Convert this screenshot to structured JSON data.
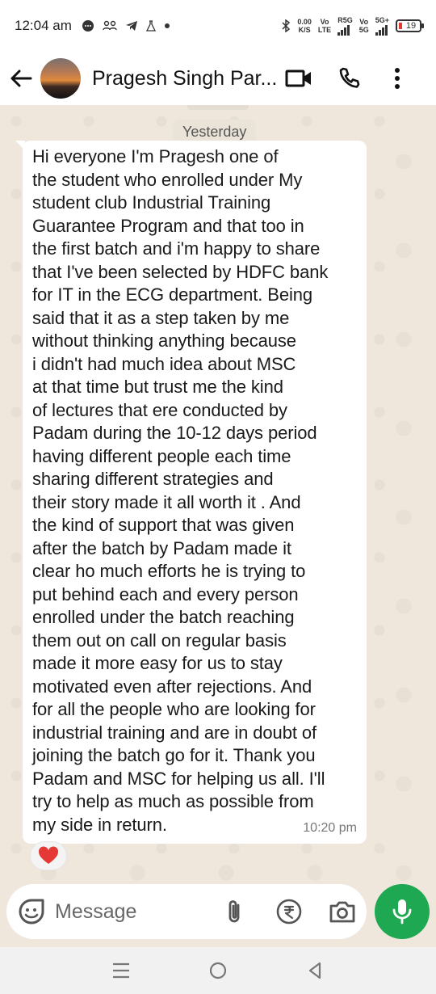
{
  "status_bar": {
    "time": "12:04 am",
    "speed_value": "0.00",
    "speed_unit": "K/S",
    "net1_top": "Vo",
    "net1_bottom": "LTE",
    "net1_type": "R5G",
    "net2_top": "Vo",
    "net2_bottom": "5G",
    "net2_type": "5G+",
    "battery": "19"
  },
  "header": {
    "contact_name": "Pragesh Singh Par..."
  },
  "chat": {
    "date_chip": "Yesterday",
    "message": {
      "text": "Hi everyone I'm Pragesh one of\nthe student who enrolled under My\nstudent club Industrial Training\nGuarantee Program and that too in\nthe first batch and i'm happy to share\nthat I've been selected by HDFC bank\nfor IT in the ECG department. Being\nsaid that it as a step taken by me\nwithout thinking anything because\ni didn't had much idea about MSC\nat that time but trust me the kind\nof lectures that ere conducted by\nPadam during the 10-12 days period\nhaving different people each time\nsharing different strategies and\ntheir story made it all worth it . And\nthe kind of support that was  given\nafter the batch by Padam made it\nclear ho much efforts he is trying to\nput behind each and every person\nenrolled under the batch reaching\nthem out on call on regular basis\nmade it more easy for us to stay\nmotivated even after rejections. And\nfor all the people who are looking for\nindustrial training and are in doubt of\njoining the batch go for it. Thank you\nPadam and MSC for helping us all. I'll\ntry to help as much as possible from\nmy side in return.",
      "time": "10:20 pm",
      "reaction": "heart"
    }
  },
  "composer": {
    "placeholder": "Message"
  },
  "colors": {
    "accent_green": "#1da851",
    "chat_bg": "#efe7dc",
    "bubble_bg": "#ffffff",
    "reaction_red": "#e53935"
  }
}
